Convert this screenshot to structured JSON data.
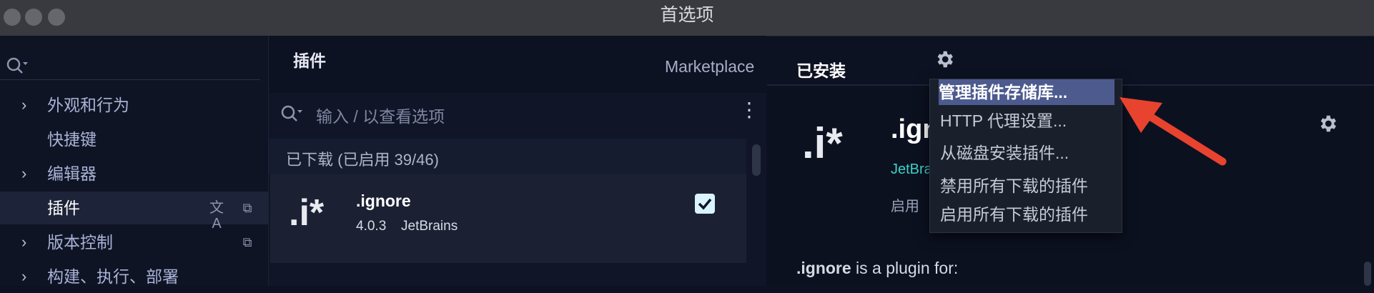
{
  "window": {
    "title": "首选项"
  },
  "left": {
    "search_placeholder": "",
    "items": [
      {
        "label": "外观和行为",
        "has_chevron": true
      },
      {
        "label": "快捷键",
        "has_chevron": false
      },
      {
        "label": "编辑器",
        "has_chevron": true
      },
      {
        "label": "插件",
        "has_chevron": false,
        "selected": true
      },
      {
        "label": "版本控制",
        "has_chevron": true
      },
      {
        "label": "构建、执行、部署",
        "has_chevron": true
      }
    ]
  },
  "plugins": {
    "header": "插件",
    "tabs": {
      "marketplace": "Marketplace",
      "installed": "已安装"
    },
    "search_placeholder": "输入 / 以查看选项",
    "section_label": "已下载 (已启用 39/46)",
    "card": {
      "logo": ".i*",
      "name": ".ignore",
      "version": "4.0.3",
      "vendor": "JetBrains",
      "enabled": true
    }
  },
  "detail": {
    "logo": ".i*",
    "name_partial": ".ign",
    "vendor_partial": "JetBra",
    "enable_label": "启用",
    "description_name": ".ignore",
    "description_rest": " is a plugin for:"
  },
  "settings_menu": {
    "items": [
      "管理插件存储库...",
      "HTTP 代理设置...",
      "从磁盘安装插件...",
      "禁用所有下载的插件",
      "启用所有下载的插件"
    ],
    "selected_index": 0
  },
  "colors": {
    "accent_teal": "#3fd1c4",
    "selection": "#4c5a8e",
    "annotation_arrow": "#e8432f"
  },
  "icons": [
    "search-icon",
    "gear-icon",
    "more-vertical-icon",
    "translate-icon",
    "copy-icon",
    "chevron-right-icon",
    "checkbox-checked-icon",
    "arrow-annotation"
  ]
}
